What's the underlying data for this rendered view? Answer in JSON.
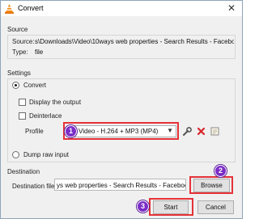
{
  "window": {
    "title": "Convert"
  },
  "source": {
    "section_label": "Source",
    "source_label": "Source:",
    "source_value": "s\\Downloads\\Video\\10ways web properties - Search Results - Facebook.mkv",
    "type_label": "Type:",
    "type_value": "file"
  },
  "settings": {
    "section_label": "Settings",
    "convert_label": "Convert",
    "display_output_label": "Display the output",
    "deinterlace_label": "Deinterlace",
    "profile_label": "Profile",
    "profile_value": "Video - H.264 + MP3 (MP4)",
    "dump_raw_label": "Dump raw input"
  },
  "destination": {
    "section_label": "Destination",
    "file_label": "Destination file:",
    "file_value": "ys web properties - Search Results - Facebook.mkv",
    "browse_label": "Browse"
  },
  "footer": {
    "start_label": "Start",
    "cancel_label": "Cancel"
  },
  "annotations": {
    "badge_1": "1",
    "badge_2": "2",
    "badge_3": "3"
  },
  "colors": {
    "highlight": "#e53238",
    "badge": "#7b2dc8"
  }
}
